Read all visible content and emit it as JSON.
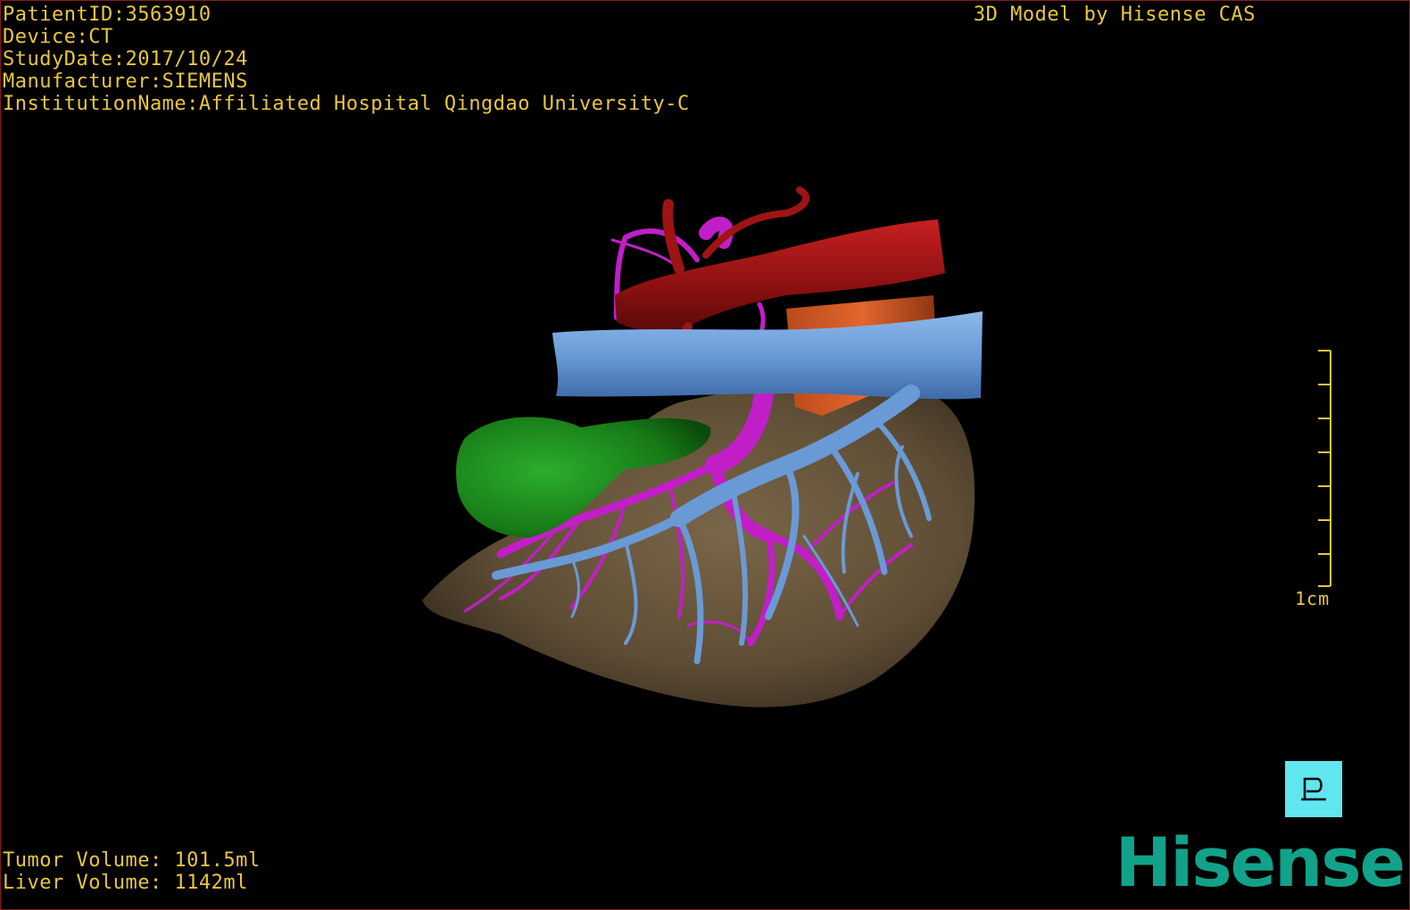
{
  "header": {
    "patient_id": "PatientID:3563910",
    "device": "Device:CT",
    "study_date": "StudyDate:2017/10/24",
    "manufacturer": "Manufacturer:SIEMENS",
    "institution": "InstitutionName:Affiliated Hospital Qingdao University-C",
    "brand_text": "3D Model by Hisense CAS"
  },
  "footer": {
    "tumor_volume": "Tumor Volume: 101.5ml",
    "liver_volume": "Liver Volume: 1142ml"
  },
  "scale_bar": {
    "label": "1cm"
  },
  "orientation_button": {
    "icon": "posterior-orientation-icon"
  },
  "logo": {
    "text": "Hisense"
  },
  "colors": {
    "overlay_text": "#e8c640",
    "liver": "#6b5a40",
    "hepatic_artery": "#9e1414",
    "vena_cava": "#6a9ad6",
    "portal_vein": "#c21ec8",
    "tumor": "#1e8a1e",
    "orientation_button": "#5fe6ee",
    "logo": "#12a28a"
  }
}
